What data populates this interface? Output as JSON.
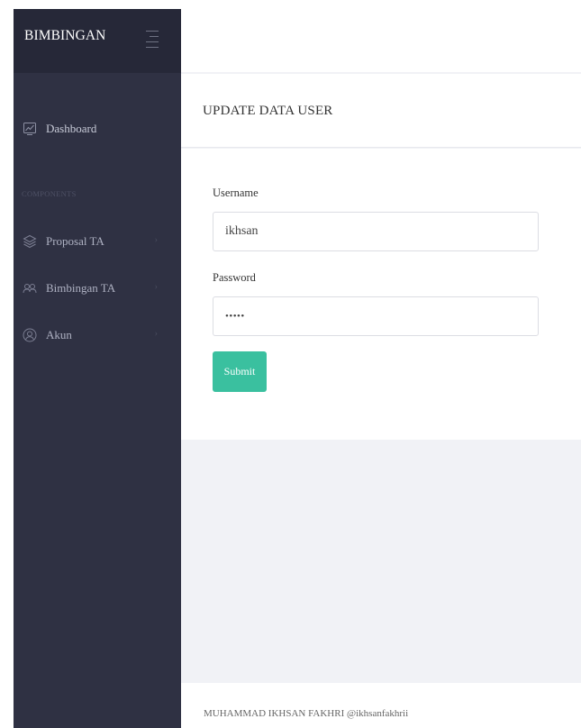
{
  "sidebar": {
    "brand": "BIMBINGAN",
    "section_label": "COMPONENTS",
    "items": [
      {
        "label": "Dashboard",
        "icon": "chart-icon"
      },
      {
        "label": "Proposal TA",
        "icon": "layers-icon"
      },
      {
        "label": "Bimbingan TA",
        "icon": "users-icon"
      },
      {
        "label": "Akun",
        "icon": "user-circle-icon"
      }
    ]
  },
  "card": {
    "title": "UPDATE DATA USER",
    "username_label": "Username",
    "username_value": "ikhsan",
    "password_label": "Password",
    "password_value": "•••••",
    "submit_label": "Submit"
  },
  "footer": {
    "text": "MUHAMMAD IKHSAN FAKHRI @ikhsanfakhrii"
  },
  "colors": {
    "sidebar_bg": "#2f3143",
    "brand_bg": "#262838",
    "accent": "#3ac09f"
  }
}
